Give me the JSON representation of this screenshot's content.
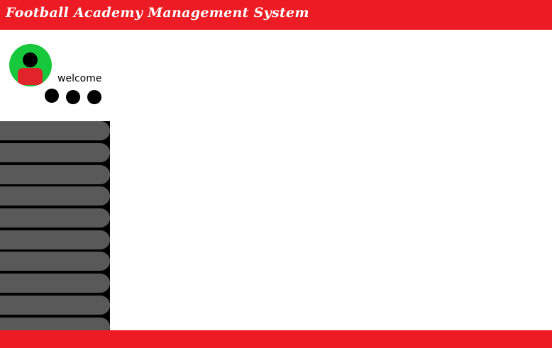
{
  "app": {
    "title": "Football Academy Management System"
  },
  "user": {
    "welcome_text": "welcome"
  },
  "colors": {
    "header": "#ed1c24",
    "footer": "#ed1c24",
    "avatar_bg": "#18c83c",
    "avatar_body": "#e1232a",
    "sidebar_bg": "#000000",
    "nav_button": "#595959"
  },
  "sidebar": {
    "items": [
      {
        "label": ""
      },
      {
        "label": ""
      },
      {
        "label": ""
      },
      {
        "label": ""
      },
      {
        "label": ""
      },
      {
        "label": ""
      },
      {
        "label": ""
      },
      {
        "label": ""
      },
      {
        "label": ""
      },
      {
        "label": ""
      }
    ]
  }
}
